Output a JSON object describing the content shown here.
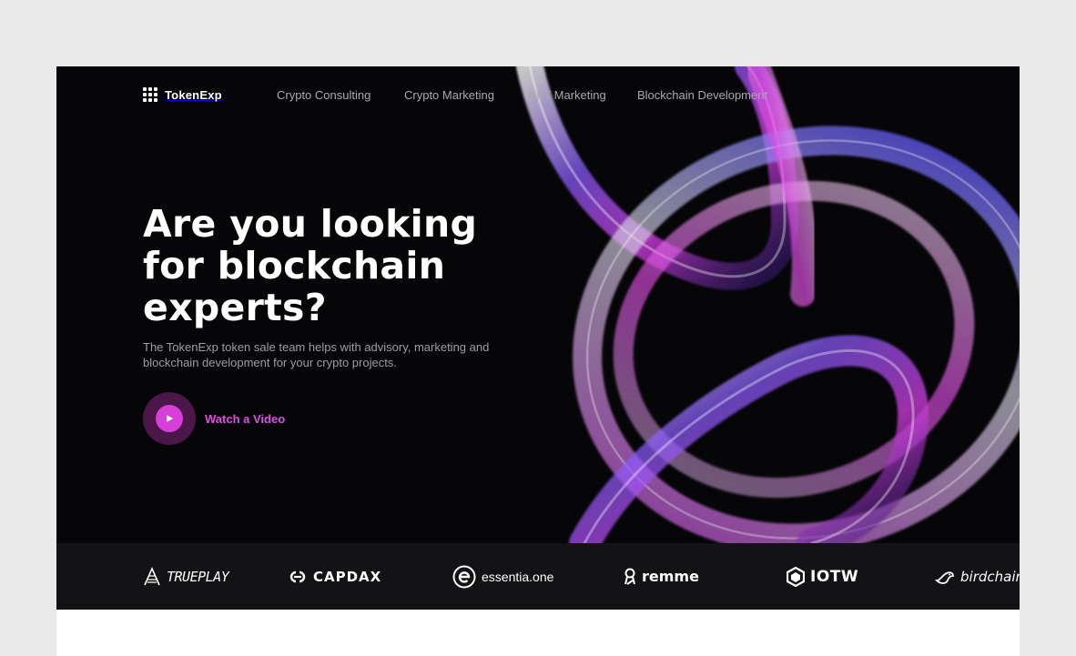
{
  "brand": {
    "name": "TokenExp"
  },
  "nav": {
    "links": [
      "Crypto Consulting",
      "Crypto Marketing",
      "NFT Marketing",
      "Blockchain Development"
    ]
  },
  "hero": {
    "headline_lines": [
      "Are you looking",
      "for blockchain",
      "experts?"
    ],
    "subtext": "The TokenExp token sale team helps with advisory, marketing and blockchain development for your crypto projects.",
    "video_label": "Watch a Video"
  },
  "partners": {
    "logos": [
      {
        "name": "TRUEPLAY",
        "icon": "trueplay-logo-icon"
      },
      {
        "name": "CAPDAX",
        "icon": "capdax-logo-icon"
      },
      {
        "name": "essentia.one",
        "icon": "essentia-logo-icon"
      },
      {
        "name": "remme",
        "icon": "remme-logo-icon"
      },
      {
        "name": "IOTW",
        "icon": "iotw-logo-icon"
      },
      {
        "name": "birdchain",
        "icon": "birdchain-logo-icon"
      }
    ]
  },
  "colors": {
    "page_background": "#e9e9ea",
    "hero_background": "#060608",
    "partner_strip": "#131315",
    "accent_magenta": "#e04ce4",
    "accent_blue": "#4a3cff"
  }
}
